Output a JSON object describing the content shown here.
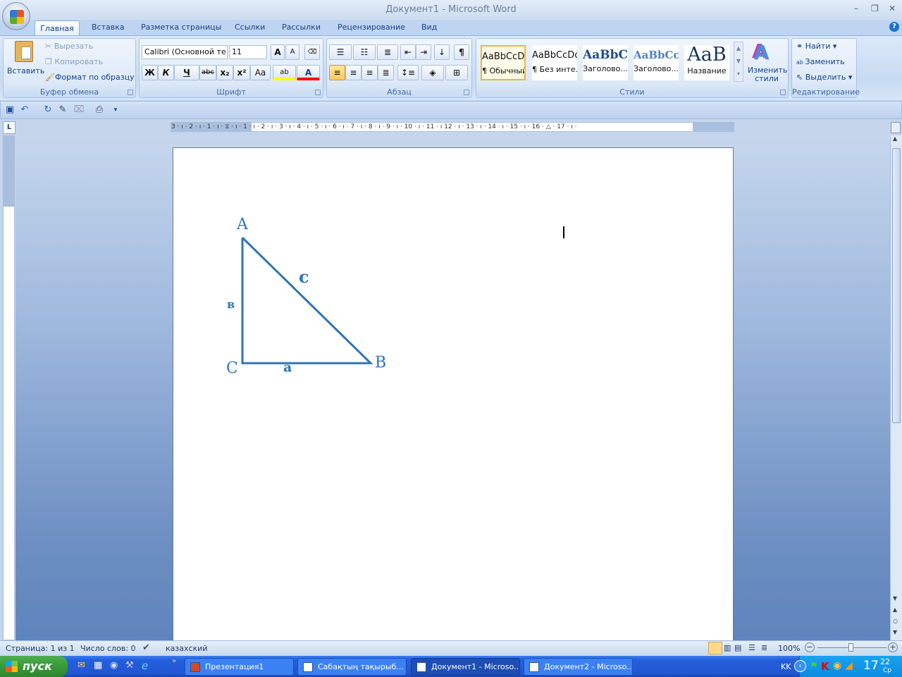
{
  "window": {
    "title": "Документ1 - Microsoft Word",
    "minimize": "–",
    "restore": "❐",
    "close": "✕"
  },
  "tabs": [
    "Главная",
    "Вставка",
    "Разметка страницы",
    "Ссылки",
    "Рассылки",
    "Рецензирование",
    "Вид"
  ],
  "help_icon": "?",
  "clipboard": {
    "paste": "Вставить",
    "cut": "Вырезать",
    "copy": "Копировать",
    "format_painter": "Формат по образцу",
    "label": "Буфер обмена"
  },
  "font": {
    "name": "Calibri (Основной те",
    "size": "11",
    "grow": "A",
    "shrink": "A",
    "bold": "Ж",
    "italic": "К",
    "underline": "Ч",
    "strike": "abc",
    "sub": "x₂",
    "sup": "x²",
    "case": "Aa",
    "highlight": "ab",
    "color": "A",
    "label": "Шрифт",
    "highlight_color": "#ffff00",
    "font_color": "#ff0000"
  },
  "paragraph": {
    "label": "Абзац",
    "pilcrow": "¶"
  },
  "styles": {
    "label": "Стили",
    "items": [
      {
        "sample": "AaBbCcDc",
        "name": "¶ Обычный"
      },
      {
        "sample": "AaBbCcDc",
        "name": "¶ Без инте..."
      },
      {
        "sample": "AaBbC",
        "name": "Заголово..."
      },
      {
        "sample": "AaBbCc",
        "name": "Заголово..."
      },
      {
        "sample": "AaB",
        "name": "Название"
      }
    ],
    "change": "Изменить стили"
  },
  "editing": {
    "find": "Найти",
    "replace": "Заменить",
    "select": "Выделить",
    "label": "Редактирование"
  },
  "ruler": {
    "ticks": "3 · ı · 2 · ı · 1 · ı · ⧖ · ı · 1 · ı · 2 · ı · 3 · ı · 4 · ı · 5 · ı · 6 · ı · 7 · ı · 8 · ı · 9 · ı · 10 · ı · 11 · ı 12 · ı · 13 · ı · 14 · ı · 15 · ı · 16 · △ · 17 · ı ·"
  },
  "drawing": {
    "vertex_a": "A",
    "vertex_b": "B",
    "vertex_c": "C",
    "side_a": "a",
    "side_b": "в",
    "side_c": "c",
    "color": "#2e75b6"
  },
  "status": {
    "page": "Страница: 1 из 1",
    "words": "Число слов: 0",
    "language": "казахский",
    "zoom": "100%",
    "zoom_level": 100
  },
  "taskbar": {
    "start": "пуск",
    "tasks": [
      "Презентация1",
      "Сабақтың тақырыб...",
      "Документ1 - Microso...",
      "Документ2 - Microso..."
    ],
    "lang": "KK",
    "time": "17",
    "time_min": "22",
    "day": "Ср"
  }
}
